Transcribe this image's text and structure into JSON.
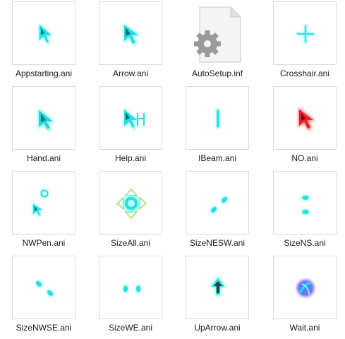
{
  "files": [
    {
      "name": "Appstarting.ani",
      "icon": "appstarting-cursor-icon"
    },
    {
      "name": "Arrow.ani",
      "icon": "arrow-cursor-icon"
    },
    {
      "name": "AutoSetup.inf",
      "icon": "settings-file-icon"
    },
    {
      "name": "Crosshair.ani",
      "icon": "crosshair-cursor-icon"
    },
    {
      "name": "Hand.ani",
      "icon": "hand-cursor-icon"
    },
    {
      "name": "Help.ani",
      "icon": "help-cursor-icon"
    },
    {
      "name": "IBeam.ani",
      "icon": "ibeam-cursor-icon"
    },
    {
      "name": "NO.ani",
      "icon": "no-cursor-icon"
    },
    {
      "name": "NWPen.ani",
      "icon": "pen-cursor-icon"
    },
    {
      "name": "SizeAll.ani",
      "icon": "size-all-cursor-icon"
    },
    {
      "name": "SizeNESW.ani",
      "icon": "size-nesw-cursor-icon"
    },
    {
      "name": "SizeNS.ani",
      "icon": "size-ns-cursor-icon"
    },
    {
      "name": "SizeNWSE.ani",
      "icon": "size-nwse-cursor-icon"
    },
    {
      "name": "SizeWE.ani",
      "icon": "size-we-cursor-icon"
    },
    {
      "name": "UpArrow.ani",
      "icon": "up-arrow-cursor-icon"
    },
    {
      "name": "Wait.ani",
      "icon": "wait-cursor-icon"
    }
  ],
  "colors": {
    "cyan": "#22e0e0",
    "glow": "#7ff6f6",
    "red": "#e8202a",
    "violet": "#6a5cff",
    "green": "#9ee06a",
    "gear": "#9a9a9a"
  }
}
